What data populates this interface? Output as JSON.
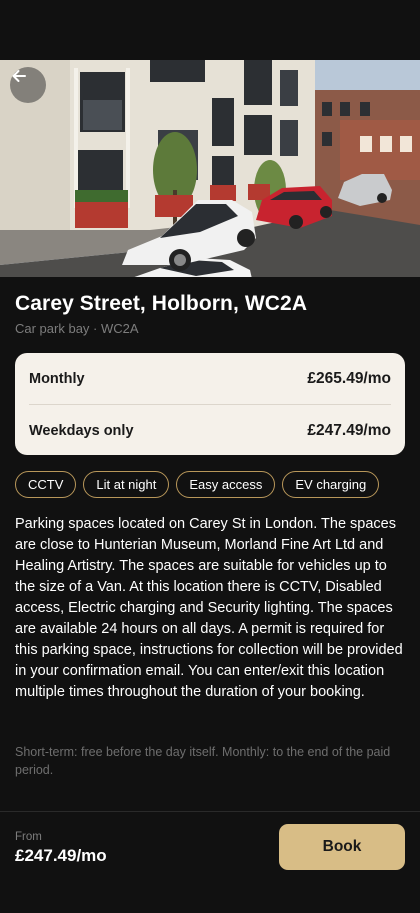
{
  "header": {
    "back_icon": "arrow-left-icon"
  },
  "listing": {
    "title": "Carey Street, Holborn, WC2A",
    "subtitle": "Car park bay · WC2A"
  },
  "pricing": {
    "rows": [
      {
        "label": "Monthly",
        "amount": "£265.49/mo"
      },
      {
        "label": "Weekdays only",
        "amount": "£247.49/mo"
      }
    ]
  },
  "features": [
    "CCTV",
    "Lit at night",
    "Easy access",
    "EV charging"
  ],
  "description": "Parking spaces located on Carey St in London. The spaces are close to Hunterian Museum, Morland Fine Art Ltd and Healing Artistry. The spaces are suitable for vehicles up to the size of a Van. At this location there is CCTV, Disabled access, Electric charging and Security lighting. The spaces are available 24 hours on all days. A permit is required for this parking space, instructions for collection will be provided in your confirmation email. You can enter/exit this location multiple times throughout the duration of your booking.",
  "policy": "Short-term: free before the day itself. Monthly: to the end of the paid period.",
  "footer": {
    "from_label": "From",
    "from_price": "£247.49/mo",
    "book_label": "Book"
  },
  "colors": {
    "background": "#111111",
    "card": "#f5f1ea",
    "accent": "#d8bd86",
    "chip_border": "#b8975a",
    "muted": "#7d7d7d"
  }
}
